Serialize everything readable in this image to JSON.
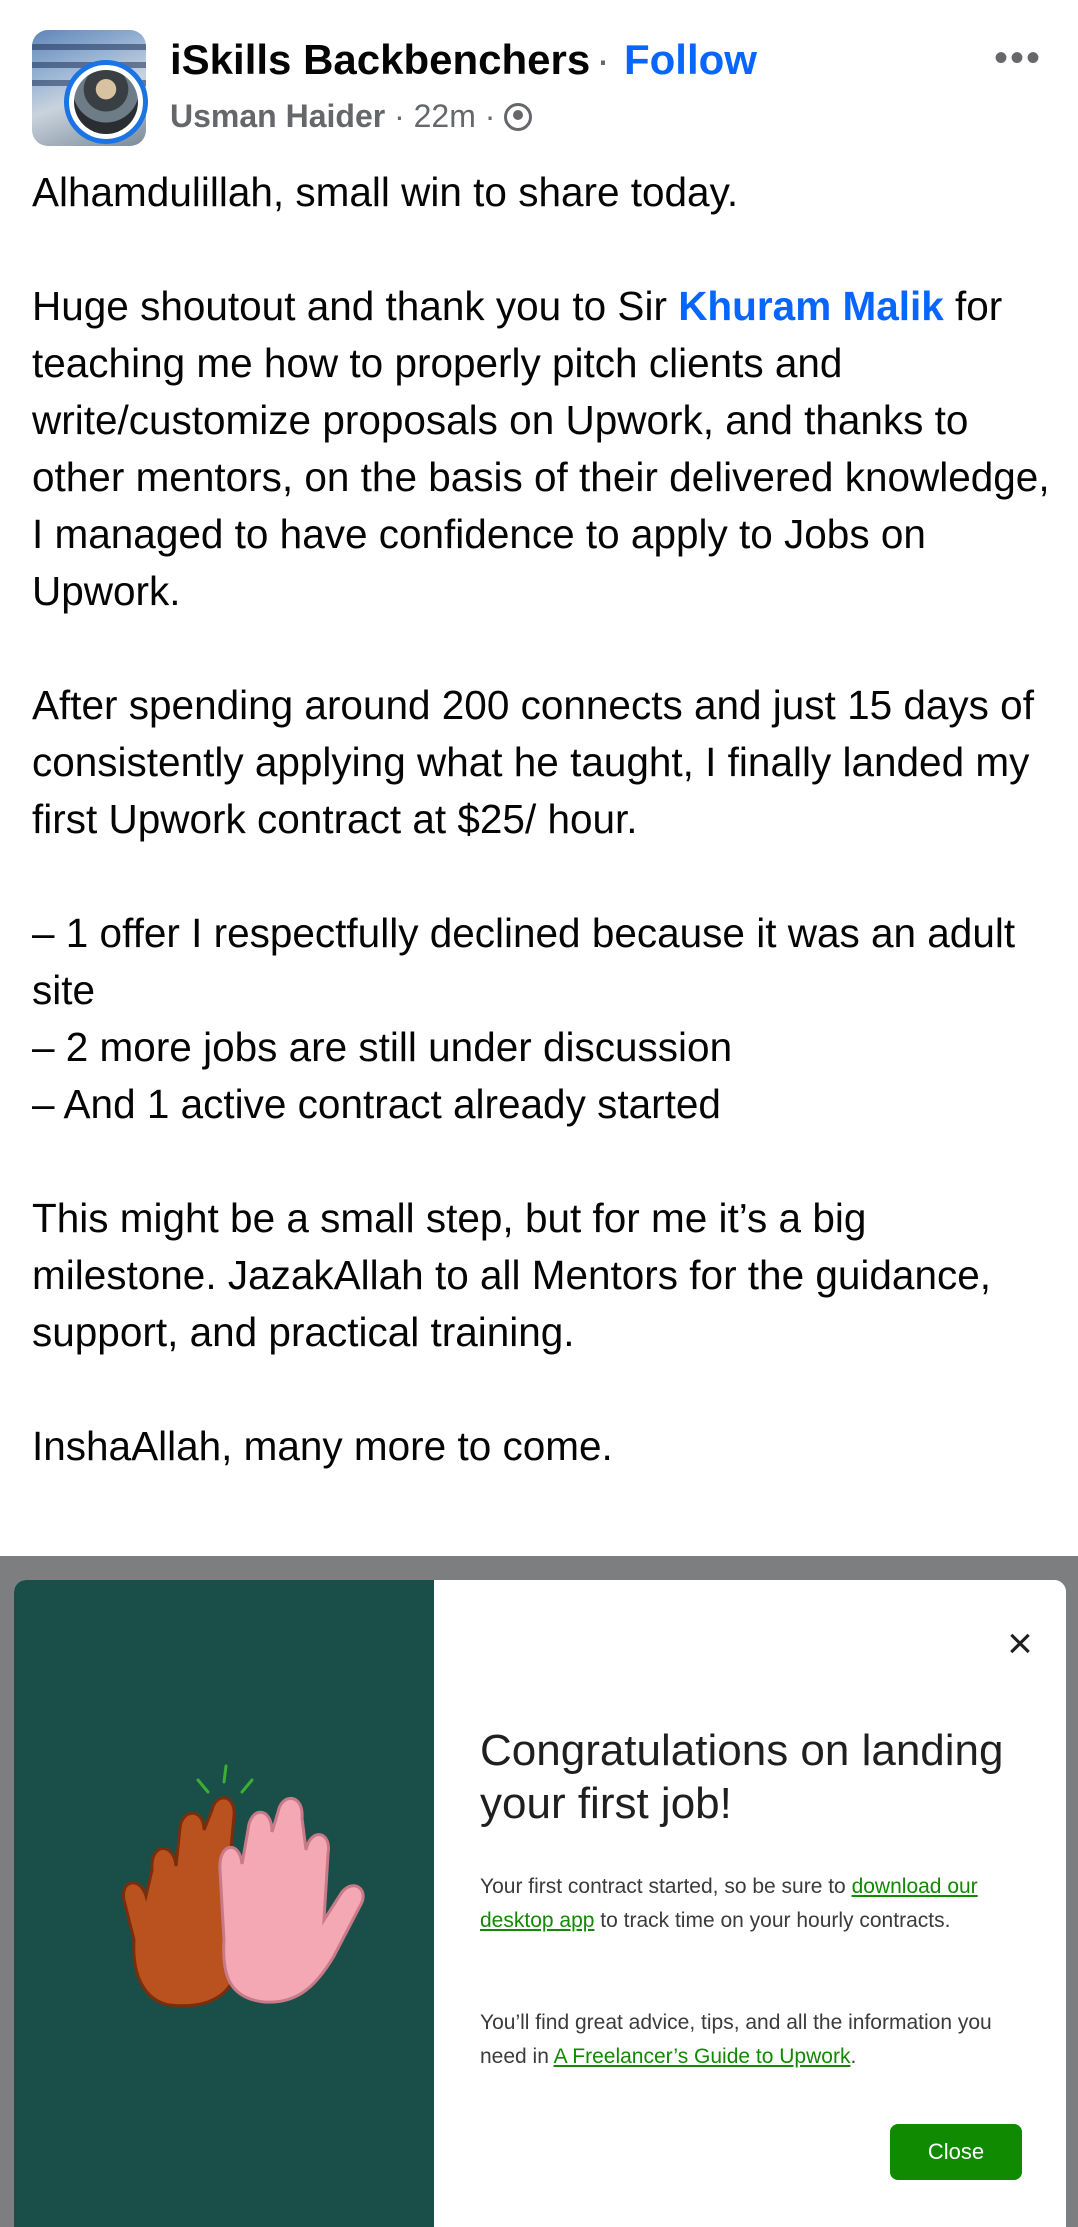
{
  "header": {
    "group_name": "iSkills Backbenchers",
    "separator": "·",
    "follow_label": "Follow",
    "more_label": "•••",
    "author": "Usman Haider",
    "time": "22m",
    "meta_sep": "·",
    "audience_icon": "globe-icon"
  },
  "post": {
    "p1": "Alhamdulillah, small win to share today.",
    "p2_before": "Huge shoutout and thank you to Sir ",
    "p2_mention": "Khuram Malik",
    "p2_after": " for teaching me how to properly pitch clients and write/customize proposals on Upwork, and thanks to other mentors, on the basis of their delivered knowledge, I managed to have confidence to apply to Jobs on Upwork.",
    "p3": "After spending around 200 connects and just 15 days of consistently applying what he taught, I finally landed my first Upwork contract at $25/ hour.",
    "bullets": [
      "– 1 offer I respectfully declined because it was an adult site",
      "– 2 more jobs are still under discussion",
      "– And 1 active contract already started"
    ],
    "p5": "This might be a small step, but for me it’s a big milestone. JazakAllah to all Mentors for the guidance, support, and practical training.",
    "p6": "InshaAllah, many more to come."
  },
  "modal": {
    "illustration": "high-five-hands",
    "close_icon": "×",
    "title": "Congratulations on landing your first job!",
    "text1_before": "Your first contract started, so be sure to ",
    "text1_link": "download our desktop app",
    "text1_after": " to track time on your hourly contracts.",
    "text2_before": "You’ll find great advice, tips, and all the information you need in ",
    "text2_link": "A Freelancer’s Guide to Upwork",
    "text2_after": ".",
    "close_button": "Close"
  },
  "colors": {
    "link_blue": "#0866ff",
    "upwork_green": "#108a00",
    "modal_left_bg": "#1a4e49",
    "overlay": "#7c7e80"
  }
}
